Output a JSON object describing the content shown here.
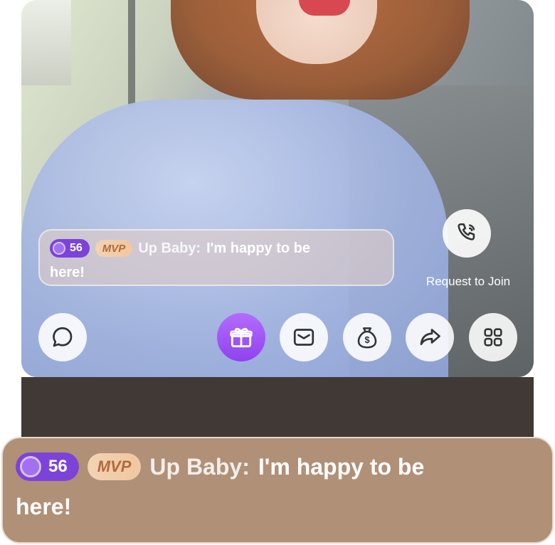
{
  "comment": {
    "level": "56",
    "badge": "MVP",
    "username": "Up Baby:",
    "message": "I'm happy to be",
    "message_cont": "here!"
  },
  "join": {
    "label": "Request to Join",
    "icon": "phone-icon"
  },
  "actions": [
    {
      "name": "chat",
      "icon": "chat-bubble-icon"
    },
    {
      "name": "gift",
      "icon": "gift-icon"
    },
    {
      "name": "message",
      "icon": "envelope-icon"
    },
    {
      "name": "money",
      "icon": "money-bag-icon"
    },
    {
      "name": "share",
      "icon": "share-arrow-icon"
    },
    {
      "name": "more",
      "icon": "grid-icon"
    }
  ],
  "colors": {
    "level_badge": "#7c43d8",
    "gift_button": "#a35cf5",
    "zoom_panel": "#b09077"
  }
}
